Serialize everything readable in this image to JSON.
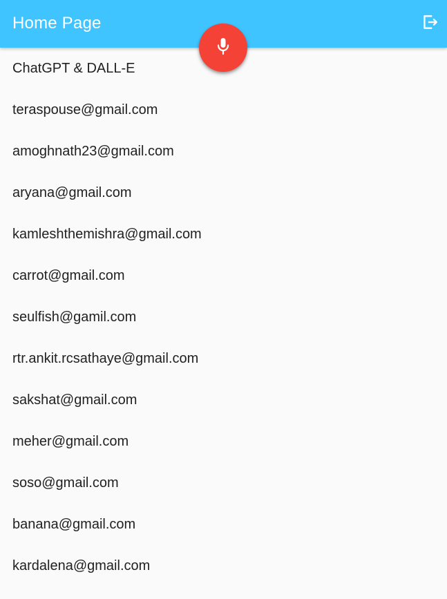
{
  "app_bar": {
    "title": "Home Page",
    "logout_icon": "logout-icon",
    "background_color": "#40c4ff"
  },
  "fab": {
    "icon": "mic-icon",
    "color": "#f44336"
  },
  "list": {
    "items": [
      "ChatGPT & DALL-E",
      "teraspouse@gmail.com",
      "amoghnath23@gmail.com",
      "aryana@gmail.com",
      "kamleshthemishra@gmail.com",
      "carrot@gmail.com",
      "seulfish@gamil.com",
      "rtr.ankit.rcsathaye@gmail.com",
      "sakshat@gmail.com",
      "meher@gmail.com",
      "soso@gmail.com",
      "banana@gmail.com",
      "kardalena@gmail.com"
    ]
  }
}
